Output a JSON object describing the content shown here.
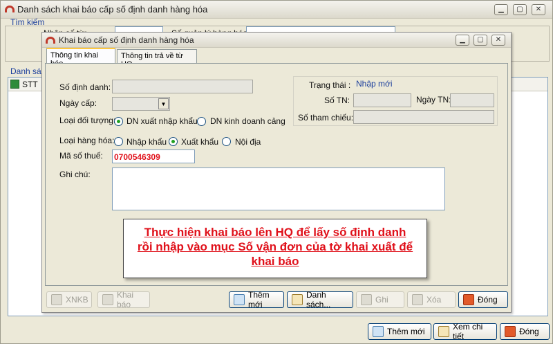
{
  "outer": {
    "title": "Danh sách khai báo cấp số định danh hàng hóa",
    "search_group": "Tìm kiếm",
    "search_label_left": "Nhập số từ:",
    "search_label_right": "Số quản lý hàng hóa:",
    "list_group": "Danh sác",
    "grid_col": "STT",
    "buttons": {
      "add": "Thêm mới",
      "view": "Xem chi tiết",
      "close": "Đóng"
    }
  },
  "dialog": {
    "title": "Khai báo cấp số định danh hàng hóa",
    "tabs": [
      "Thông tin khai báo",
      "Thông tin trả về từ HQ"
    ],
    "labels": {
      "so_dinh_danh": "Số định danh:",
      "ngay_cap": "Ngày cấp:",
      "loai_doi_tuong": "Loại đối tượng:",
      "loai_hang_hoa": "Loại hàng hóa:",
      "ma_so_thue": "Mã số thuế:",
      "ghi_chu": "Ghi chú:",
      "trang_thai": "Trạng thái :",
      "trang_thai_value": "Nhập mới",
      "so_tn": "Số TN:",
      "ngay_tn": "Ngày TN:",
      "so_tham_chieu": "Số tham chiếu:"
    },
    "doi_tuong_options": [
      "DN xuất nhập khẩu",
      "DN kinh doanh cảng"
    ],
    "hang_hoa_options": [
      "Nhập khẩu",
      "Xuất khẩu",
      "Nội địa"
    ],
    "ma_so_thue_value": "0700546309",
    "buttons": {
      "xnkb": "XNKB",
      "khai_bao": "Khai báo",
      "them_moi": "Thêm mới",
      "danh_sach": "Danh sách...",
      "ghi": "Ghi",
      "xoa": "Xóa",
      "dong": "Đóng"
    },
    "note": "Thực hiện khai báo lên HQ để lấy số định danh rồi nhập vào mục Số vận đơn của tờ khai xuất để khai báo"
  }
}
